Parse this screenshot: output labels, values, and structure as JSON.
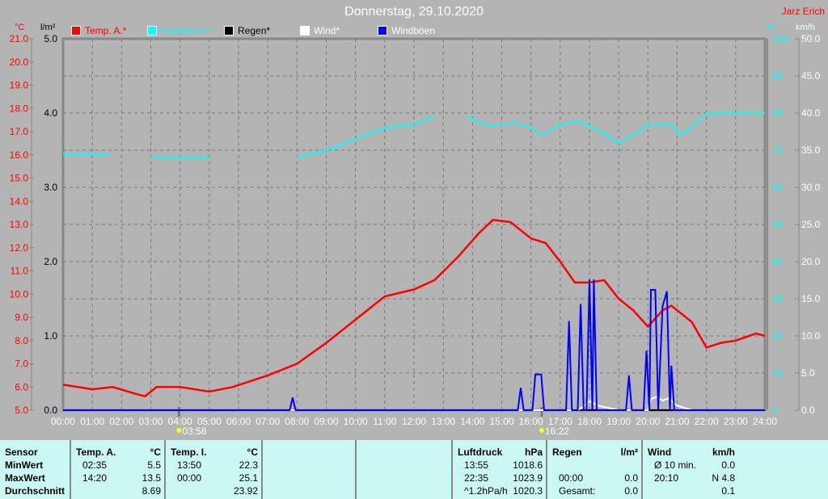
{
  "header": {
    "title": "Donnerstag, 29.10.2020",
    "author": "Jarz Erich"
  },
  "legend": [
    {
      "label": "Temp. A.*",
      "color": "#ff0000"
    },
    {
      "label": "Feuchte A.*",
      "color": "#00ffff"
    },
    {
      "label": "Regen*",
      "color": "#000000"
    },
    {
      "label": "Wind*",
      "color": "#ffffff"
    },
    {
      "label": "Windböen",
      "color": "#0000ff"
    }
  ],
  "chart_data": {
    "type": "line",
    "title": "Donnerstag, 29.10.2020",
    "x_ticks": [
      "00:00",
      "01:00",
      "02:00",
      "03:00",
      "04:00",
      "05:00",
      "06:00",
      "07:00",
      "08:00",
      "09:00",
      "10:00",
      "11:00",
      "12:00",
      "13:00",
      "14:00",
      "15:00",
      "16:00",
      "17:00",
      "18:00",
      "19:00",
      "20:00",
      "21:00",
      "22:00",
      "23:00",
      "24:00"
    ],
    "axes": {
      "temp": {
        "unit": "°C",
        "range": [
          5,
          21
        ],
        "ticks": [
          "21.0",
          "20.0",
          "19.0",
          "18.0",
          "17.0",
          "16.0",
          "15.0",
          "14.0",
          "13.0",
          "12.0",
          "11.0",
          "10.0",
          "9.0",
          "8.0",
          "7.0",
          "6.0",
          "5.0"
        ]
      },
      "rain": {
        "unit": "l/m²",
        "range": [
          0,
          5
        ],
        "ticks": [
          "5.0",
          "4.0",
          "3.0",
          "2.0",
          "1.0",
          "0.0"
        ]
      },
      "humidity": {
        "unit": "%",
        "range": [
          0,
          100
        ],
        "ticks": [
          "100",
          "90",
          "80",
          "70",
          "60",
          "50",
          "40",
          "30",
          "20",
          "10",
          "0"
        ]
      },
      "wind": {
        "unit": "km/h",
        "range": [
          0,
          50
        ],
        "ticks": [
          "50.0",
          "45.0",
          "40.0",
          "35.0",
          "30.0",
          "25.0",
          "20.0",
          "15.0",
          "10.0",
          "5.0",
          "0.0"
        ]
      }
    },
    "sun": {
      "sunrise": "03:58",
      "sunset": "16:22"
    },
    "series": [
      {
        "name": "Temp. A.",
        "axis": "temp",
        "color": "#ff0000",
        "points": [
          [
            0,
            6.1
          ],
          [
            1,
            5.9
          ],
          [
            1.7,
            6.0
          ],
          [
            2.5,
            5.7
          ],
          [
            2.8,
            5.6
          ],
          [
            3.2,
            6.0
          ],
          [
            4,
            6.0
          ],
          [
            5,
            5.8
          ],
          [
            5.8,
            6.0
          ],
          [
            7,
            6.5
          ],
          [
            8,
            7.0
          ],
          [
            9,
            7.9
          ],
          [
            10,
            8.9
          ],
          [
            11,
            9.9
          ],
          [
            12,
            10.2
          ],
          [
            12.7,
            10.6
          ],
          [
            13.5,
            11.6
          ],
          [
            14.2,
            12.6
          ],
          [
            14.7,
            13.2
          ],
          [
            15.3,
            13.1
          ],
          [
            16,
            12.4
          ],
          [
            16.5,
            12.2
          ],
          [
            17,
            11.4
          ],
          [
            17.5,
            10.5
          ],
          [
            18,
            10.5
          ],
          [
            18.5,
            10.6
          ],
          [
            19,
            9.8
          ],
          [
            19.5,
            9.3
          ],
          [
            20,
            8.6
          ],
          [
            20.5,
            9.3
          ],
          [
            20.8,
            9.5
          ],
          [
            21.5,
            8.8
          ],
          [
            22,
            7.7
          ],
          [
            22.5,
            7.9
          ],
          [
            23,
            8.0
          ],
          [
            23.7,
            8.3
          ],
          [
            24,
            8.2
          ]
        ]
      },
      {
        "name": "Feuchte A.",
        "axis": "humidity",
        "color": "#00ffff",
        "segments": [
          [
            [
              0,
              69
            ],
            [
              1.6,
              69
            ]
          ],
          [
            [
              3,
              68
            ],
            [
              5,
              68
            ]
          ],
          [
            [
              8,
              68
            ],
            [
              9,
              70
            ],
            [
              10,
              73
            ],
            [
              11,
              76
            ],
            [
              12,
              77
            ],
            [
              12.7,
              79
            ]
          ],
          [
            [
              13.8,
              79
            ],
            [
              14.6,
              76.5
            ],
            [
              15.5,
              77.5
            ],
            [
              16,
              76
            ],
            [
              16.4,
              74
            ],
            [
              17,
              77
            ],
            [
              17.6,
              78
            ],
            [
              18.4,
              75
            ],
            [
              19,
              72
            ],
            [
              19.5,
              74
            ],
            [
              20,
              77
            ],
            [
              20.8,
              77
            ],
            [
              21.1,
              74
            ],
            [
              21.6,
              77
            ],
            [
              22,
              80
            ],
            [
              24,
              80
            ]
          ]
        ]
      },
      {
        "name": "Regen",
        "axis": "rain",
        "color": "#000000",
        "points": [
          [
            0,
            0
          ],
          [
            24,
            0
          ]
        ]
      },
      {
        "name": "Wind",
        "axis": "wind",
        "color": "#ffffff",
        "points": [
          [
            0,
            0
          ],
          [
            17.6,
            0
          ],
          [
            17.8,
            0.5
          ],
          [
            18,
            1.2
          ],
          [
            18.3,
            0.6
          ],
          [
            19,
            0
          ],
          [
            20,
            0
          ],
          [
            20.1,
            1.5
          ],
          [
            20.3,
            1.8
          ],
          [
            20.5,
            1.3
          ],
          [
            20.7,
            1.6
          ],
          [
            21,
            0.6
          ],
          [
            21.5,
            0
          ],
          [
            24,
            0
          ]
        ]
      },
      {
        "name": "Windböen",
        "axis": "wind",
        "color": "#0000ff",
        "points": [
          [
            0,
            0
          ],
          [
            7.75,
            0
          ],
          [
            7.85,
            1.7
          ],
          [
            7.95,
            0
          ],
          [
            15.55,
            0
          ],
          [
            15.65,
            3
          ],
          [
            15.75,
            0
          ],
          [
            16.05,
            0
          ],
          [
            16.15,
            4.8
          ],
          [
            16.35,
            4.8
          ],
          [
            16.45,
            0
          ],
          [
            17.2,
            0
          ],
          [
            17.3,
            12
          ],
          [
            17.4,
            0
          ],
          [
            17.6,
            0
          ],
          [
            17.7,
            14.3
          ],
          [
            17.8,
            0
          ],
          [
            17.9,
            0
          ],
          [
            18.0,
            17.6
          ],
          [
            18.1,
            0
          ],
          [
            18.15,
            17.6
          ],
          [
            18.25,
            0
          ],
          [
            19.25,
            0
          ],
          [
            19.35,
            4.7
          ],
          [
            19.45,
            0
          ],
          [
            19.85,
            0
          ],
          [
            19.95,
            8
          ],
          [
            20.05,
            0
          ],
          [
            20.1,
            16.2
          ],
          [
            20.25,
            16.2
          ],
          [
            20.35,
            0
          ],
          [
            20.5,
            14
          ],
          [
            20.65,
            16
          ],
          [
            20.75,
            0
          ],
          [
            20.8,
            6
          ],
          [
            20.9,
            0
          ],
          [
            24,
            0
          ]
        ]
      }
    ]
  },
  "table": {
    "cols": [
      {
        "rows": [
          [
            "Sensor",
            ""
          ],
          [
            "MinWert",
            ""
          ],
          [
            "MaxWert",
            ""
          ],
          [
            "Durchschnitt",
            ""
          ]
        ]
      },
      {
        "rows": [
          [
            "Temp. A.",
            "°C"
          ],
          [
            "02:35",
            "5.5"
          ],
          [
            "14:20",
            "13.5"
          ],
          [
            "",
            "8.69"
          ]
        ]
      },
      {
        "rows": [
          [
            "Temp. I.",
            "°C"
          ],
          [
            "13:50",
            "22.3"
          ],
          [
            "00:00",
            "25.1"
          ],
          [
            "",
            "23.92"
          ]
        ]
      },
      {
        "rows": []
      },
      {
        "rows": []
      },
      {
        "rows": [
          [
            "Luftdruck",
            "hPa"
          ],
          [
            "13:55",
            "1018.6"
          ],
          [
            "22:35",
            "1023.9"
          ],
          [
            "^1.2hPa/h",
            "1020.3"
          ]
        ]
      },
      {
        "rows": [
          [
            "Regen",
            "l/m²"
          ],
          [
            "",
            ""
          ],
          [
            "00:00",
            "0.0"
          ],
          [
            "Gesamt:",
            "0.0"
          ]
        ]
      },
      {
        "rows": [
          [
            "Wind",
            "km/h"
          ],
          [
            "Ø 10 min.",
            "0.0"
          ],
          [
            "20:10",
            "N 4.8"
          ],
          [
            "",
            "0.1"
          ]
        ]
      }
    ]
  }
}
